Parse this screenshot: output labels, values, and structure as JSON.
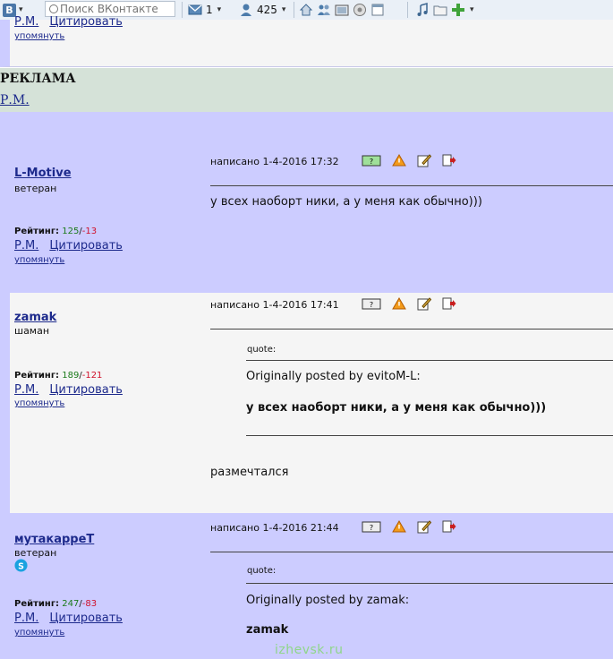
{
  "toolbar": {
    "logo": "В",
    "search_placeholder": "Поиск ВКонтакте",
    "messages_count": "1",
    "friends_count": "425",
    "icons": [
      "vk-logo-icon",
      "search-icon",
      "envelope-icon",
      "friends-icon",
      "home-icon",
      "people-icon",
      "photo-icon",
      "settings-icon",
      "window-icon",
      "music-icon",
      "folder-icon",
      "plus-icon"
    ]
  },
  "top": {
    "pm": "Р.М.",
    "cite": "Цитировать",
    "mention": "упомянуть"
  },
  "ad": {
    "title": "РЕКЛАМА",
    "pm": "Р.М."
  },
  "posts": [
    {
      "nick": "L-Motive",
      "rank": "ветеран",
      "rating_label": "Рейтинг:",
      "rating_pos": "125",
      "rating_neg": "-13",
      "pm": "Р.М.",
      "cite": "Цитировать",
      "mention": "упомянуть",
      "meta": "написано 1-4-2016 17:32",
      "text": "у всех наоборт ники, а у меня как обычно)))"
    },
    {
      "nick": "zamak",
      "rank": "шаман",
      "rating_label": "Рейтинг:",
      "rating_pos": "189",
      "rating_neg": "-121",
      "pm": "Р.М.",
      "cite": "Цитировать",
      "mention": "упомянуть",
      "meta": "написано 1-4-2016 17:41",
      "quote_label": "quote:",
      "quote_author": "Originally posted by evitoM-L:",
      "quote_text": "у всех наоборт ники, а у меня как обычно)))",
      "text": "размечтался"
    },
    {
      "nick": "мутакарреТ",
      "rank": "ветеран",
      "rating_label": "Рейтинг:",
      "rating_pos": "247",
      "rating_neg": "-83",
      "pm": "Р.М.",
      "cite": "Цитировать",
      "mention": "упомянуть",
      "meta": "написано 1-4-2016 21:44",
      "quote_label": "quote:",
      "quote_author": "Originally posted by zamak:",
      "quote_text": "zamak"
    }
  ],
  "watermark": "izhevsk.ru",
  "colors": {
    "lavender": "#ccccff",
    "ad_bg": "#d5e2d8",
    "link": "#1d2a8c",
    "positive": "#1a7a1a",
    "negative": "#d0102a"
  }
}
